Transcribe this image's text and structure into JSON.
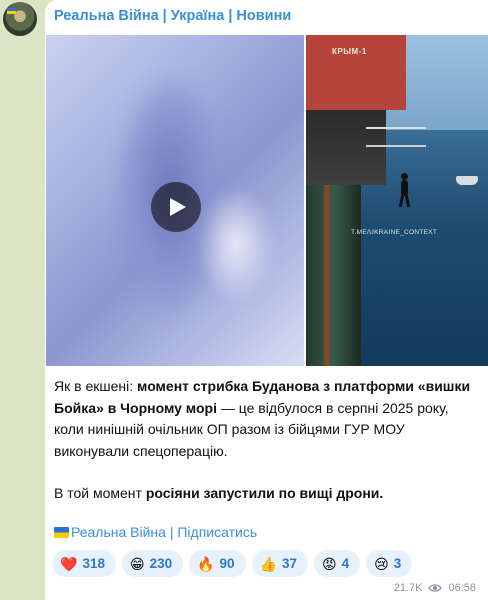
{
  "channel": {
    "title": "Реальна Війна | Україна | Новини"
  },
  "media": {
    "watermark": "T.ME/UKRAINE_CONTEXT",
    "platform_label": "КРЫМ-1"
  },
  "message": {
    "p1_plain1": "Як в екшені: ",
    "p1_bold1": "момент стрибка Буданова з платформи «вишки Бойка» в Чорному морі",
    "p1_plain2": " — це відбулося в серпні 2025 року, коли нинішній очільник ОП разом із бійцями ГУР МОУ виконували спецоперацію.",
    "p2_plain1": "В той момент ",
    "p2_bold1": "росіяни запустили по вищі дрони."
  },
  "signature": {
    "label": "Реальна Війна | Підписатись"
  },
  "reactions": [
    {
      "emoji": "❤️",
      "count": "318"
    },
    {
      "emoji": "😁",
      "count": "230"
    },
    {
      "emoji": "🔥",
      "count": "90"
    },
    {
      "emoji": "👍",
      "count": "37"
    },
    {
      "emoji": "😡",
      "count": "4"
    },
    {
      "emoji": "😢",
      "count": "3"
    }
  ],
  "meta": {
    "views": "21.7K",
    "time": "06:58"
  },
  "colors": {
    "accent": "#3a8fd9",
    "background": "#dbe5c5",
    "reaction_bg": "#e7f1fb"
  }
}
